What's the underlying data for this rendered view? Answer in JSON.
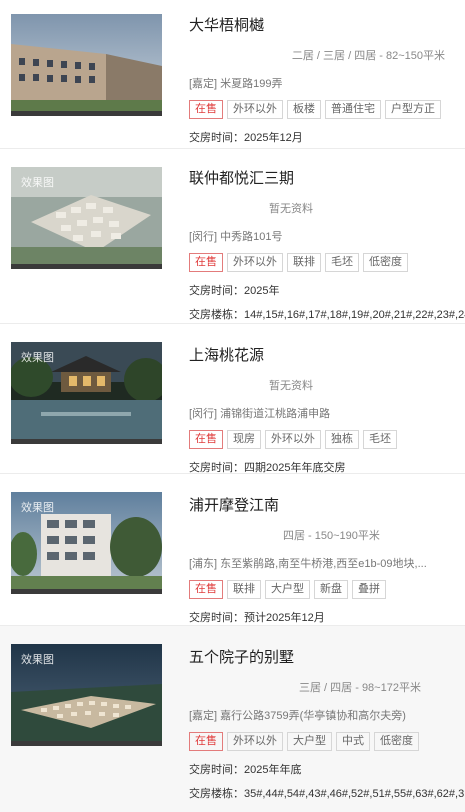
{
  "listings": [
    {
      "name": "大华梧桐樾",
      "layout": "二居 / 三居 / 四居 - 82~150平米",
      "address": "[嘉定] 米夏路199弄",
      "watermark": "",
      "tags": [
        "在售",
        "外环以外",
        "板楼",
        "普通住宅",
        "户型方正"
      ],
      "delivery_label": "交房时间：",
      "delivery": "2025年12月",
      "buildings_label": "",
      "buildings": ""
    },
    {
      "name": "联仲都悦汇三期",
      "layout": "暂无资料",
      "address": "[闵行] 中秀路101号",
      "watermark": "效果图",
      "tags": [
        "在售",
        "外环以外",
        "联排",
        "毛坯",
        "低密度"
      ],
      "delivery_label": "交房时间：",
      "delivery": "2025年",
      "buildings_label": "交房楼栋：",
      "buildings": "14#,15#,16#,17#,18#,19#,20#,21#,22#,23#,24#"
    },
    {
      "name": "上海桃花源",
      "layout": "暂无资料",
      "address": "[闵行] 浦锦街道江桃路浦申路",
      "watermark": "效果图",
      "tags": [
        "在售",
        "现房",
        "外环以外",
        "独栋",
        "毛坯"
      ],
      "delivery_label": "交房时间：",
      "delivery": "四期2025年年底交房",
      "buildings_label": "",
      "buildings": ""
    },
    {
      "name": "浦开摩登江南",
      "layout": "四居 - 150~190平米",
      "address": "[浦东] 东至紫鹃路,南至牛桥港,西至e1b-09地块,...",
      "watermark": "效果图",
      "tags": [
        "在售",
        "联排",
        "大户型",
        "新盘",
        "叠拼"
      ],
      "delivery_label": "交房时间：",
      "delivery": "预计2025年12月",
      "buildings_label": "",
      "buildings": ""
    },
    {
      "name": "五个院子的别墅",
      "layout": "三居 / 四居 - 98~172平米",
      "address": "[嘉定] 嘉行公路3759弄(华亭镇协和高尔夫旁)",
      "watermark": "效果图",
      "tags": [
        "在售",
        "外环以外",
        "大户型",
        "中式",
        "低密度"
      ],
      "delivery_label": "交房时间：",
      "delivery": "2025年年底",
      "buildings_label": "交房楼栋：",
      "buildings": "35#,44#,54#,43#,46#,52#,51#,55#,63#,62#,3"
    }
  ]
}
